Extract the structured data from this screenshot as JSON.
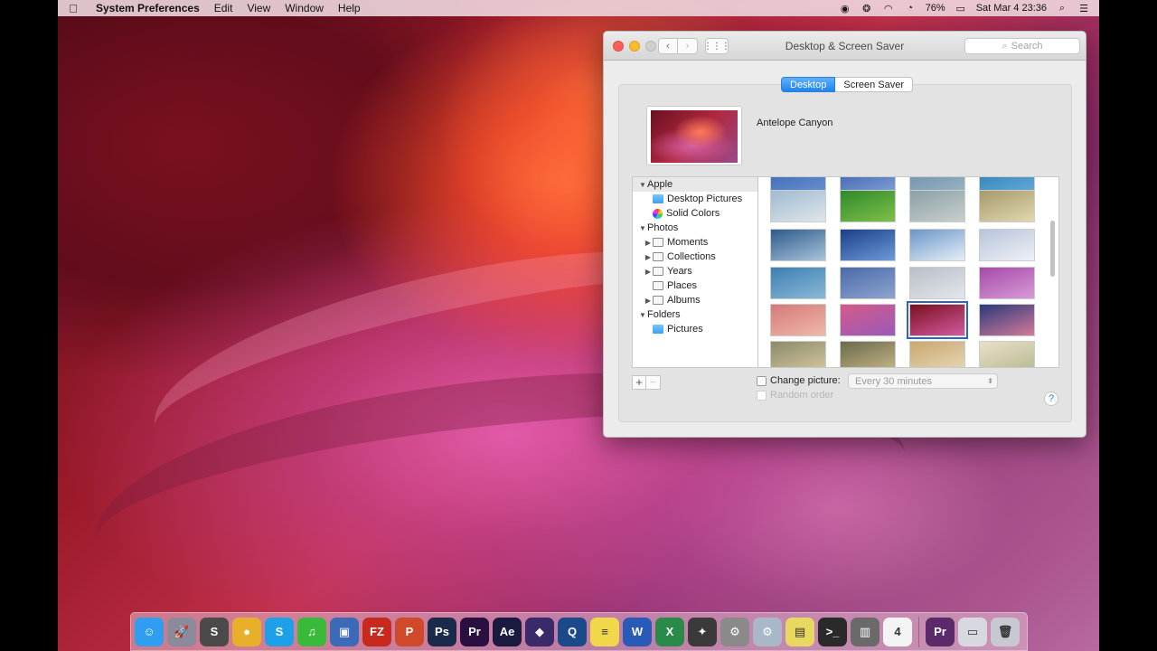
{
  "menubar": {
    "app": "System Preferences",
    "items": [
      "Edit",
      "View",
      "Window",
      "Help"
    ],
    "battery": "76%",
    "clock": "Sat Mar 4  23:36"
  },
  "window": {
    "title": "Desktop & Screen Saver",
    "search_placeholder": "Search",
    "tabs": [
      "Desktop",
      "Screen Saver"
    ],
    "selected_tab": "Desktop",
    "wallpaper_name": "Antelope Canyon",
    "sidebar": [
      {
        "label": "Apple",
        "level": 0,
        "expanded": true,
        "icon": "none"
      },
      {
        "label": "Desktop Pictures",
        "level": 1,
        "icon": "blue-folder-icon"
      },
      {
        "label": "Solid Colors",
        "level": 1,
        "icon": "color-wheel-icon"
      },
      {
        "label": "Photos",
        "level": 0,
        "expanded": true,
        "icon": "none"
      },
      {
        "label": "Moments",
        "level": 1,
        "collapsed": true,
        "icon": "gray-folder-icon"
      },
      {
        "label": "Collections",
        "level": 1,
        "collapsed": true,
        "icon": "gray-folder-icon"
      },
      {
        "label": "Years",
        "level": 1,
        "collapsed": true,
        "icon": "gray-folder-icon"
      },
      {
        "label": "Places",
        "level": 1,
        "icon": "gray-folder-icon"
      },
      {
        "label": "Albums",
        "level": 1,
        "collapsed": true,
        "icon": "gray-folder-icon"
      },
      {
        "label": "Folders",
        "level": 0,
        "expanded": true,
        "icon": "none"
      },
      {
        "label": "Pictures",
        "level": 1,
        "icon": "blue-folder-icon"
      }
    ],
    "change_picture_label": "Change picture:",
    "change_picture_interval": "Every 30 minutes",
    "random_order_label": "Random order",
    "help_label": "?",
    "add_label": "+",
    "remove_label": "−",
    "selected_thumbnail": 14
  },
  "thumbnails": [
    {
      "c1": "#3a6ab8",
      "c2": "#6f93d0"
    },
    {
      "c1": "#3a5fb0",
      "c2": "#8aa8d8"
    },
    {
      "c1": "#6c8fa8",
      "c2": "#9eb8c8"
    },
    {
      "c1": "#2c7fb8",
      "c2": "#6bb0d8"
    },
    {
      "c1": "#9fbad0",
      "c2": "#dfe6ea"
    },
    {
      "c1": "#2f8a2a",
      "c2": "#7ec04a"
    },
    {
      "c1": "#8aa0a8",
      "c2": "#c9cfcc"
    },
    {
      "c1": "#a49a6a",
      "c2": "#e2d8b0"
    },
    {
      "c1": "#2e5a8a",
      "c2": "#a9c4dc"
    },
    {
      "c1": "#1c3f88",
      "c2": "#6c9ad8"
    },
    {
      "c1": "#6a96c8",
      "c2": "#e6eef6"
    },
    {
      "c1": "#b8c4da",
      "c2": "#eef0f6"
    },
    {
      "c1": "#3d7fb0",
      "c2": "#8ab8d8"
    },
    {
      "c1": "#4a6aa8",
      "c2": "#8ea4d0"
    },
    {
      "c1": "#b8bec8",
      "c2": "#e4e6ea"
    },
    {
      "c1": "#a44aa8",
      "c2": "#d89ad8"
    },
    {
      "c1": "#d47a7a",
      "c2": "#f0b8a8"
    },
    {
      "c1": "#d45a8a",
      "c2": "#9a5ab8"
    },
    {
      "c1": "#7a1020",
      "c2": "#d45aa0"
    },
    {
      "c1": "#2a3a7a",
      "c2": "#d47a9a"
    },
    {
      "c1": "#8a8a6a",
      "c2": "#d8c8a0"
    },
    {
      "c1": "#6a6a4a",
      "c2": "#c8b88a"
    },
    {
      "c1": "#c8a870",
      "c2": "#e8d8b8"
    },
    {
      "c1": "#e8e0c8",
      "c2": "#b8b890"
    }
  ],
  "dock": [
    {
      "name": "finder",
      "bg": "#2f9df0",
      "t": "☺"
    },
    {
      "name": "launchpad",
      "bg": "#8a8a9a",
      "t": "🚀"
    },
    {
      "name": "sublime",
      "bg": "#4a4a4a",
      "t": "S"
    },
    {
      "name": "chrome",
      "bg": "#e8b02a",
      "t": "●"
    },
    {
      "name": "skype",
      "bg": "#1ea0e8",
      "t": "S"
    },
    {
      "name": "itunes",
      "bg": "#3aba3a",
      "t": "♫"
    },
    {
      "name": "virtualbox",
      "bg": "#3a6ab8",
      "t": "▣"
    },
    {
      "name": "filezilla",
      "bg": "#c8281e",
      "t": "FZ"
    },
    {
      "name": "powerpoint",
      "bg": "#d04a2a",
      "t": "P"
    },
    {
      "name": "photoshop",
      "bg": "#1a2a4a",
      "t": "Ps"
    },
    {
      "name": "premiere",
      "bg": "#2a1040",
      "t": "Pr"
    },
    {
      "name": "after-effects",
      "bg": "#1a1a40",
      "t": "Ae"
    },
    {
      "name": "motion",
      "bg": "#3a2a6a",
      "t": "◆"
    },
    {
      "name": "quicktime",
      "bg": "#1a4a8a",
      "t": "Q"
    },
    {
      "name": "notes",
      "bg": "#f0d84a",
      "t": "≡"
    },
    {
      "name": "word",
      "bg": "#2a5ab8",
      "t": "W"
    },
    {
      "name": "excel",
      "bg": "#2a8a4a",
      "t": "X"
    },
    {
      "name": "safari",
      "bg": "#3a3a3a",
      "t": "✦"
    },
    {
      "name": "system-preferences",
      "bg": "#8a8a8a",
      "t": "⚙"
    },
    {
      "name": "utility",
      "bg": "#a8b8c8",
      "t": "⚙"
    },
    {
      "name": "stickies",
      "bg": "#e8d860",
      "t": "▤"
    },
    {
      "name": "terminal",
      "bg": "#2a2a2a",
      "t": ">_"
    },
    {
      "name": "archive",
      "bg": "#6a6a6a",
      "t": "▥"
    },
    {
      "name": "calendar",
      "bg": "#f4f4f4",
      "t": "4"
    },
    {
      "name": "premiere-pro",
      "bg": "#5a2a6a",
      "t": "Pr"
    },
    {
      "name": "downloads",
      "bg": "#d8d8e0",
      "t": "▭"
    },
    {
      "name": "trash",
      "bg": "#c8c8d0",
      "t": "🗑"
    }
  ]
}
